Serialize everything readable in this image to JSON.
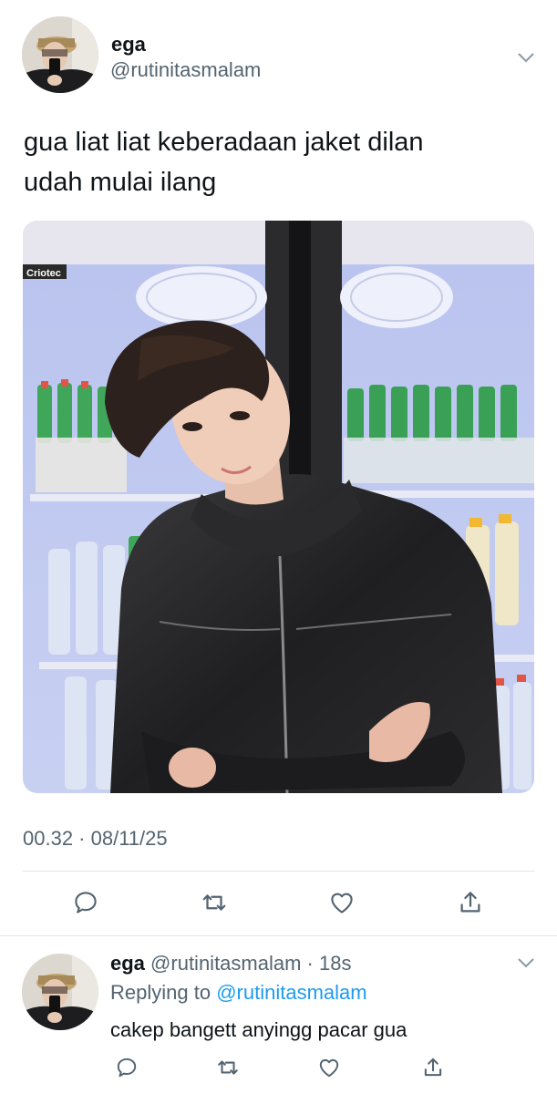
{
  "tweet": {
    "author_name": "ega",
    "author_handle": "@rutinitasmalam",
    "text_lines": [
      "gua liat liat keberadaan jaket dilan",
      "udah mulai ilang"
    ],
    "image_label": "Criotec",
    "timestamp": "00.32 · 08/11/25",
    "actions": [
      "reply-icon",
      "retweet-icon",
      "like-icon",
      "share-icon"
    ]
  },
  "reply": {
    "author_name": "ega",
    "author_handle_time": "@rutinitasmalam · 18s",
    "replying_prefix": "Replying to",
    "replying_handle": "@rutinitasmalam",
    "text": "cakep bangett anyingg pacar gua",
    "actions": [
      "reply-icon",
      "retweet-icon",
      "like-icon",
      "share-icon"
    ]
  },
  "colors": {
    "text": "#0f1419",
    "secondary": "#536471",
    "link": "#1d9bf0",
    "divider": "#e1e6ea"
  }
}
